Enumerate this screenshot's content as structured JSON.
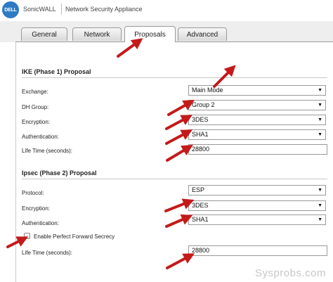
{
  "header": {
    "logo_text": "DELL",
    "brand": "SonicWALL",
    "product": "Network Security Appliance"
  },
  "tabs": [
    {
      "label": "General",
      "active": false
    },
    {
      "label": "Network",
      "active": false
    },
    {
      "label": "Proposals",
      "active": true
    },
    {
      "label": "Advanced",
      "active": false
    }
  ],
  "ike": {
    "title": "IKE (Phase 1) Proposal",
    "exchange_label": "Exchange:",
    "exchange_value": "Main Mode",
    "dh_label": "DH Group:",
    "dh_value": "Group 2",
    "encryption_label": "Encryption:",
    "encryption_value": "3DES",
    "auth_label": "Authentication:",
    "auth_value": "SHA1",
    "lifetime_label": "Life Time (seconds):",
    "lifetime_value": "28800"
  },
  "ipsec": {
    "title": "Ipsec (Phase 2) Proposal",
    "protocol_label": "Protocol:",
    "protocol_value": "ESP",
    "encryption_label": "Encryption:",
    "encryption_value": "3DES",
    "auth_label": "Authentication:",
    "auth_value": "SHA1",
    "pfs_label": "Enable Perfect Forward Secrecy",
    "pfs_checked": false,
    "lifetime_label": "Life Time (seconds):",
    "lifetime_value": "28800"
  },
  "watermark": "Sysprobs.com",
  "arrow_color": "#c41a1a"
}
